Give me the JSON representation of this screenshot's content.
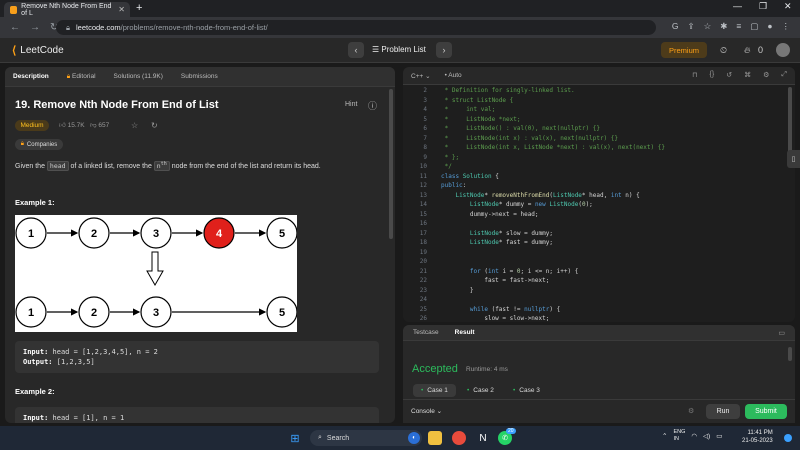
{
  "browser": {
    "tab_title": "Remove Nth Node From End of L",
    "url_domain": "leetcode.com",
    "url_path": "/problems/remove-nth-node-from-end-of-list/"
  },
  "navbar": {
    "logo_text": "LeetCode",
    "problem_list": "Problem List",
    "premium": "Premium",
    "streak": "0"
  },
  "left_tabs": [
    "Description",
    "Editorial",
    "Solutions (11.9K)",
    "Submissions"
  ],
  "problem": {
    "title": "19. Remove Nth Node From End of List",
    "hint": "Hint",
    "difficulty": "Medium",
    "likes": "15.7K",
    "dislikes": "657",
    "companies": "Companies",
    "desc_before": "Given the ",
    "desc_code": "head",
    "desc_mid": " of a linked list, remove the ",
    "desc_code2": "n",
    "desc_sup": "th",
    "desc_after": " node from the end of the list and return its head.",
    "example1_title": "Example 1:",
    "example1_input_label": "Input:",
    "example1_input": " head = [1,2,3,4,5], n = 2",
    "example1_output_label": "Output:",
    "example1_output": " [1,2,3,5]",
    "example2_title": "Example 2:",
    "example2_input_label": "Input:",
    "example2_input": " head = [1], n = 1"
  },
  "diagram": {
    "top_nodes": [
      "1",
      "2",
      "3",
      "4",
      "5"
    ],
    "bottom_nodes": [
      "1",
      "2",
      "3",
      "5"
    ],
    "removed_color": "#e0201b"
  },
  "editor": {
    "language": "C++",
    "mode": "Auto",
    "lines": [
      {
        "n": "2",
        "t": " * Definition for singly-linked list."
      },
      {
        "n": "3",
        "t": " * struct ListNode {"
      },
      {
        "n": "4",
        "t": " *     int val;"
      },
      {
        "n": "5",
        "t": " *     ListNode *next;"
      },
      {
        "n": "6",
        "t": " *     ListNode() : val(0), next(nullptr) {}"
      },
      {
        "n": "7",
        "t": " *     ListNode(int x) : val(x), next(nullptr) {}"
      },
      {
        "n": "8",
        "t": " *     ListNode(int x, ListNode *next) : val(x), next(next) {}"
      },
      {
        "n": "9",
        "t": " * };"
      },
      {
        "n": "10",
        "t": " */"
      },
      {
        "n": "11",
        "t": "class Solution {"
      },
      {
        "n": "12",
        "t": "public:"
      },
      {
        "n": "13",
        "t": "    ListNode* removeNthFromEnd(ListNode* head, int n) {"
      },
      {
        "n": "14",
        "t": "        ListNode* dummy = new ListNode(0);"
      },
      {
        "n": "15",
        "t": "        dummy->next = head;"
      },
      {
        "n": "16",
        "t": ""
      },
      {
        "n": "17",
        "t": "        ListNode* slow = dummy;"
      },
      {
        "n": "18",
        "t": "        ListNode* fast = dummy;"
      },
      {
        "n": "19",
        "t": ""
      },
      {
        "n": "20",
        "t": ""
      },
      {
        "n": "21",
        "t": "        for (int i = 0; i <= n; i++) {"
      },
      {
        "n": "22",
        "t": "            fast = fast->next;"
      },
      {
        "n": "23",
        "t": "        }"
      },
      {
        "n": "24",
        "t": ""
      },
      {
        "n": "25",
        "t": "        while (fast != nullptr) {"
      },
      {
        "n": "26",
        "t": "            slow = slow->next;"
      }
    ]
  },
  "result": {
    "tabs": [
      "Testcase",
      "Result"
    ],
    "status": "Accepted",
    "runtime": "Runtime: 4 ms",
    "cases": [
      "Case 1",
      "Case 2",
      "Case 3"
    ]
  },
  "actions": {
    "console": "Console",
    "run": "Run",
    "submit": "Submit"
  },
  "taskbar": {
    "search": "Search",
    "lang_top": "ENG",
    "lang_bottom": "IN",
    "time": "11:41 PM",
    "date": "21-05-2023",
    "badge": "20"
  },
  "colors": {
    "accent": "#ffa116",
    "accepted": "#2cbb5d",
    "medium": "#ffc01e"
  }
}
